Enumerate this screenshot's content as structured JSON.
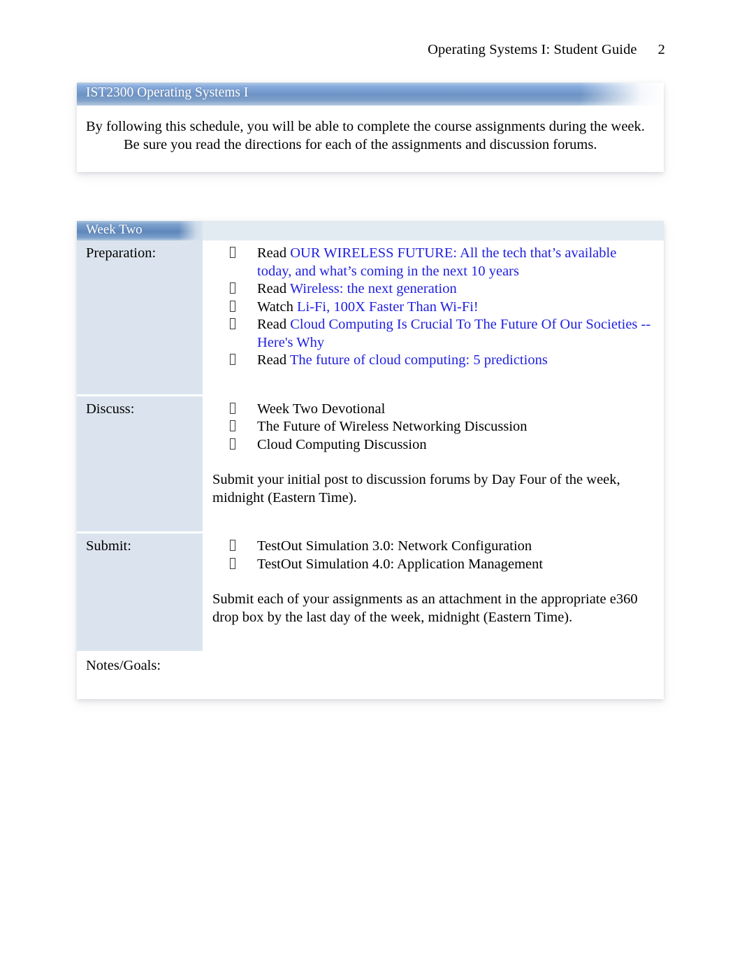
{
  "header": {
    "title": "Operating Systems I: Student Guide",
    "page_number": "2"
  },
  "intro": {
    "banner_title": "IST2300 Operating Systems I",
    "paragraph": "By following this schedule, you will be able to complete the course assignments during the week. Be sure you read the directions for each of the assignments and discussion forums."
  },
  "schedule": {
    "week_header": "Week Two",
    "rows": {
      "preparation": {
        "label": "Preparation:",
        "items": [
          {
            "prefix": "Read ",
            "link": "OUR WIRELESS FUTURE: All the tech that’s available today, and what’s coming in the next 10 years"
          },
          {
            "prefix": "Read ",
            "link": "Wireless: the next generation"
          },
          {
            "prefix": "Watch ",
            "link": " Li-Fi, 100X Faster Than Wi-Fi!"
          },
          {
            "prefix": "Read ",
            "link": "Cloud Computing Is Crucial To The Future Of Our Societies -- Here's Why"
          },
          {
            "prefix": "Read ",
            "link": "The future of cloud computing: 5 predictions"
          }
        ]
      },
      "discuss": {
        "label": "Discuss:",
        "items": [
          "Week Two Devotional",
          "The Future of Wireless Networking Discussion",
          "Cloud Computing Discussion"
        ],
        "note": "Submit your initial post to discussion forums by Day Four of the week, midnight (Eastern Time)."
      },
      "submit": {
        "label": "Submit:",
        "items": [
          "TestOut Simulation 3.0: Network Configuration",
          "TestOut Simulation 4.0: Application Management"
        ],
        "note": "Submit each of your assignments as an attachment in the appropriate e360 drop box by the last day of the week, midnight (Eastern Time)."
      },
      "notes": {
        "label": "Notes/Goals:"
      }
    }
  },
  "colors": {
    "banner_blue": "#6d93c4",
    "week_blue": "#5f87bb",
    "label_fill": "#dbe4ee",
    "link_blue": "#2020e0"
  }
}
